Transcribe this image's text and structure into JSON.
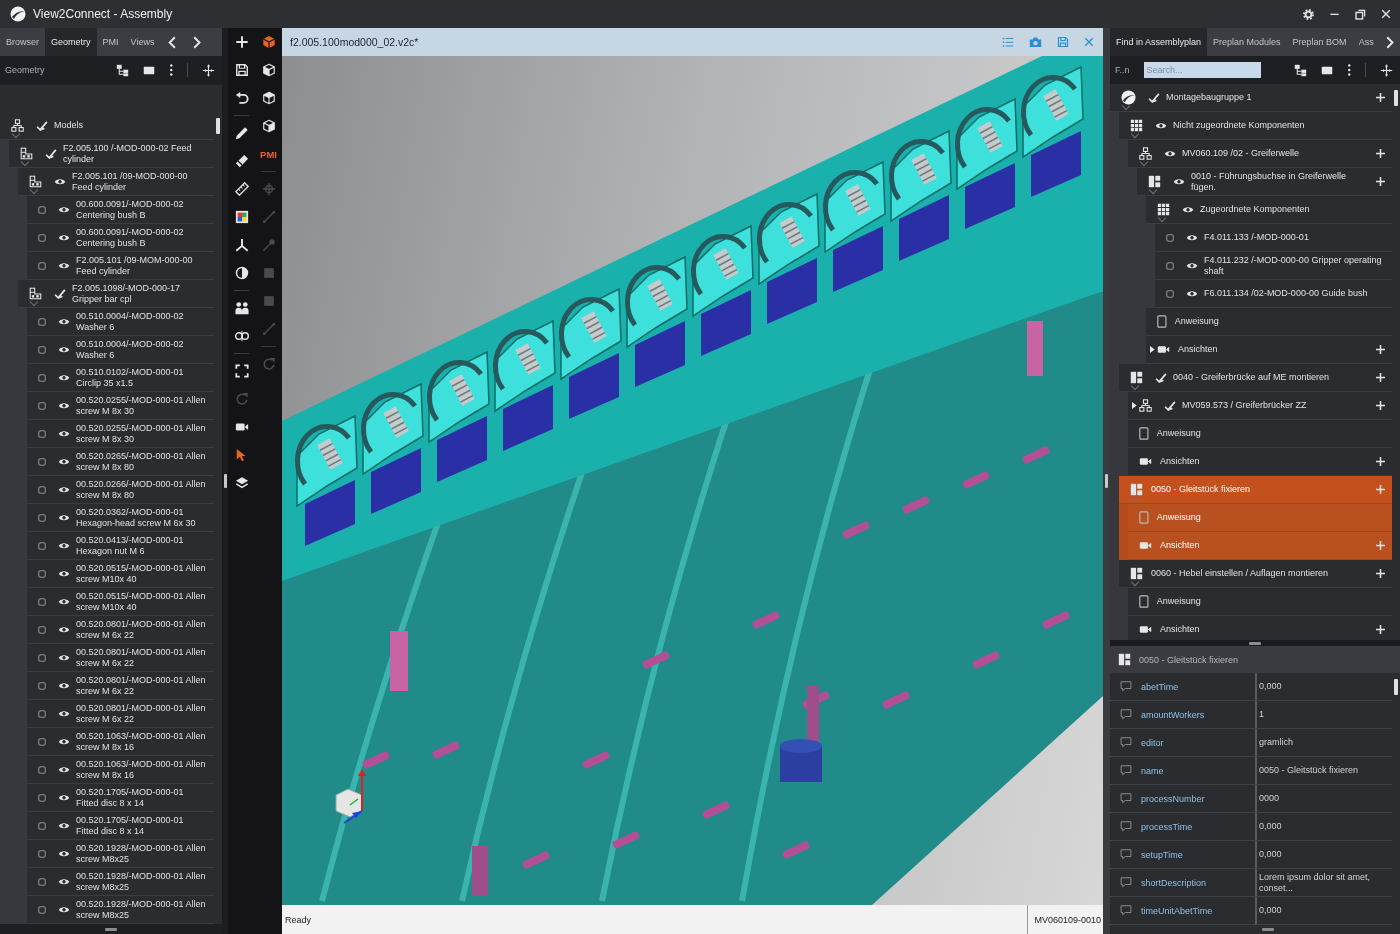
{
  "window": {
    "title": "View2Connect - Assembly"
  },
  "left_panel": {
    "tabs": [
      {
        "label": "Browser",
        "selected": false
      },
      {
        "label": "Geometry",
        "selected": true
      },
      {
        "label": "PMI",
        "selected": false
      },
      {
        "label": "Views",
        "selected": false
      }
    ],
    "toolbar_label": "Geometry",
    "tree": [
      {
        "kind": "hierarchy",
        "label": "Models",
        "mixed_visibility": true,
        "expanded": true,
        "selected": false,
        "children": [
          {
            "kind": "assembly",
            "label": "F2.005.100 /-MOD-000-02 Feed cylinder",
            "mixed_visibility": true,
            "expanded": true,
            "selected": false,
            "children": [
              {
                "kind": "assembly",
                "label": "F2.005.101 /09-MOD-000-00 Feed cylinder",
                "mixed_visibility": false,
                "expanded": true,
                "selected": false,
                "children": [
                  {
                    "kind": "part",
                    "label": "00.600.0091/-MOD-000-02 Centering bush B",
                    "mixed_visibility": false,
                    "selected": false
                  },
                  {
                    "kind": "part",
                    "label": "00.600.0091/-MOD-000-02 Centering bush B",
                    "mixed_visibility": false,
                    "selected": false
                  },
                  {
                    "kind": "part",
                    "label": "F2.005.101 /09-MOM-000-00 Feed cylinder",
                    "mixed_visibility": false,
                    "selected": false
                  }
                ]
              },
              {
                "kind": "assembly",
                "label": "F2.005.1098/-MOD-000-17 Gripper bar cpl",
                "mixed_visibility": true,
                "expanded": true,
                "selected": false,
                "children": [
                  {
                    "kind": "part",
                    "label": "00.510.0004/-MOD-000-02 Washer 6",
                    "mixed_visibility": false,
                    "selected": false
                  },
                  {
                    "kind": "part",
                    "label": "00.510.0004/-MOD-000-02 Washer 6",
                    "mixed_visibility": false,
                    "selected": false
                  },
                  {
                    "kind": "part",
                    "label": "00.510.0102/-MOD-000-01 Circlip 35 x1.5",
                    "mixed_visibility": false,
                    "selected": false
                  },
                  {
                    "kind": "part",
                    "label": "00.520.0255/-MOD-000-01 Allen screw M 8x 30",
                    "mixed_visibility": false,
                    "selected": false
                  },
                  {
                    "kind": "part",
                    "label": "00.520.0255/-MOD-000-01 Allen screw M 8x 30",
                    "mixed_visibility": false,
                    "selected": false
                  },
                  {
                    "kind": "part",
                    "label": "00.520.0265/-MOD-000-01 Allen screw M 8x 80",
                    "mixed_visibility": false,
                    "selected": false
                  },
                  {
                    "kind": "part",
                    "label": "00.520.0266/-MOD-000-01 Allen screw M 8x 80",
                    "mixed_visibility": false,
                    "selected": false
                  },
                  {
                    "kind": "part",
                    "label": "00.520.0362/-MOD-000-01 Hexagon-head screw M 6x 30",
                    "mixed_visibility": false,
                    "selected": false
                  },
                  {
                    "kind": "part",
                    "label": "00.520.0413/-MOD-000-01 Hexagon nut M 6",
                    "mixed_visibility": false,
                    "selected": false
                  },
                  {
                    "kind": "part",
                    "label": "00.520.0515/-MOD-000-01 Allen screw M10x 40",
                    "mixed_visibility": false,
                    "selected": false
                  },
                  {
                    "kind": "part",
                    "label": "00.520.0515/-MOD-000-01 Allen screw M10x 40",
                    "mixed_visibility": false,
                    "selected": false
                  },
                  {
                    "kind": "part",
                    "label": "00.520.0801/-MOD-000-01 Allen screw M 6x 22",
                    "mixed_visibility": false,
                    "selected": false
                  },
                  {
                    "kind": "part",
                    "label": "00.520.0801/-MOD-000-01 Allen screw M 6x 22",
                    "mixed_visibility": false,
                    "selected": false
                  },
                  {
                    "kind": "part",
                    "label": "00.520.0801/-MOD-000-01 Allen screw M 6x 22",
                    "mixed_visibility": false,
                    "selected": false
                  },
                  {
                    "kind": "part",
                    "label": "00.520.0801/-MOD-000-01 Allen screw M 6x 22",
                    "mixed_visibility": false,
                    "selected": false
                  },
                  {
                    "kind": "part",
                    "label": "00.520.1063/-MOD-000-01 Allen screw M 8x 16",
                    "mixed_visibility": false,
                    "selected": false
                  },
                  {
                    "kind": "part",
                    "label": "00.520.1063/-MOD-000-01 Allen screw M 8x 16",
                    "mixed_visibility": false,
                    "selected": false
                  },
                  {
                    "kind": "part",
                    "label": "00.520.1705/-MOD-000-01 Fitted disc 8 x 14",
                    "mixed_visibility": false,
                    "selected": false
                  },
                  {
                    "kind": "part",
                    "label": "00.520.1705/-MOD-000-01 Fitted disc 8 x 14",
                    "mixed_visibility": false,
                    "selected": false
                  },
                  {
                    "kind": "part",
                    "label": "00.520.1928/-MOD-000-01 Allen screw M8x25",
                    "mixed_visibility": false,
                    "selected": false
                  },
                  {
                    "kind": "part",
                    "label": "00.520.1928/-MOD-000-01 Allen screw M8x25",
                    "mixed_visibility": false,
                    "selected": false
                  },
                  {
                    "kind": "part",
                    "label": "00.520.1928/-MOD-000-01 Allen screw M8x25",
                    "mixed_visibility": false,
                    "selected": false
                  }
                ]
              }
            ]
          }
        ]
      }
    ]
  },
  "toolbar": {
    "left_tools": [
      {
        "disabled": false
      },
      {
        "disabled": false
      },
      {
        "disabled": false
      },
      {
        "disabled": false
      },
      {
        "disabled": false
      },
      {
        "disabled": false
      },
      {
        "disabled": false
      },
      {
        "disabled": false
      },
      {
        "disabled": false
      },
      {
        "disabled": false
      },
      {
        "disabled": false
      },
      {
        "disabled": false
      },
      {
        "disabled": true
      },
      {
        "disabled": false
      },
      {
        "disabled": false
      },
      {
        "disabled": false
      }
    ],
    "right_tools": [
      {
        "kind": "icon",
        "disabled": false
      },
      {
        "kind": "icon",
        "disabled": false
      },
      {
        "kind": "icon",
        "disabled": false
      },
      {
        "kind": "icon",
        "disabled": false
      },
      {
        "kind": "text",
        "label": "PMI",
        "disabled": false
      },
      {
        "kind": "icon",
        "disabled": true
      },
      {
        "kind": "icon",
        "disabled": true
      },
      {
        "kind": "icon",
        "disabled": true
      },
      {
        "kind": "icon",
        "disabled": true
      },
      {
        "kind": "icon",
        "disabled": true
      },
      {
        "kind": "icon",
        "disabled": true
      },
      {
        "kind": "icon",
        "disabled": true
      }
    ]
  },
  "viewport": {
    "document_title": "f2.005.100mod000_02.v2c*"
  },
  "status_bar": {
    "message": "Ready",
    "item_id": "MV060109-0010"
  },
  "right_panel": {
    "tabs": [
      {
        "label": "Find in Assemblyplan",
        "selected": true
      },
      {
        "label": "Preplan Modules",
        "selected": false
      },
      {
        "label": "Preplan BOM",
        "selected": false
      },
      {
        "label": "Ass",
        "selected": false
      }
    ],
    "toolbar_label": "F..n",
    "search": {
      "placeholder": "Search..."
    },
    "tree": [
      {
        "kind": "root",
        "label": "Montagebaugruppe 1",
        "mixed_visibility": true,
        "expanded": true,
        "selected": false,
        "add_button": true,
        "children": [
          {
            "kind": "components",
            "label": "Nicht zugeordnete Komponenten",
            "mixed_visibility": false,
            "expanded": true,
            "selected": false,
            "add_button": false,
            "children": [
              {
                "kind": "hierarchy",
                "label": "MV060.109 /02 - Greiferwelle",
                "mixed_visibility": false,
                "expanded": true,
                "selected": false,
                "add_button": true,
                "children": [
                  {
                    "kind": "process",
                    "label": "0010 - Führungsbuchse in Greiferwelle fügen.",
                    "mixed_visibility": false,
                    "expanded": true,
                    "selected": false,
                    "add_button": true,
                    "children": [
                      {
                        "kind": "components",
                        "label": "Zugeordnete Komponenten",
                        "mixed_visibility": false,
                        "expanded": true,
                        "selected": false,
                        "add_button": false,
                        "children": [
                          {
                            "kind": "part",
                            "label": "F4.011.133 /-MOD-000-01",
                            "mixed_visibility": false,
                            "selected": false,
                            "add_button": false
                          },
                          {
                            "kind": "part",
                            "label": "F4.011.232 /-MOD-000-00 Gripper operating shaft",
                            "mixed_visibility": false,
                            "selected": false,
                            "add_button": false
                          },
                          {
                            "kind": "part",
                            "label": "F6.011.134 /02-MOD-000-00 Guide bush",
                            "mixed_visibility": false,
                            "selected": false,
                            "add_button": false
                          }
                        ]
                      },
                      {
                        "kind": "instruction",
                        "label": "Anweisung",
                        "selected": false,
                        "add_button": false
                      },
                      {
                        "kind": "views",
                        "label": "Ansichten",
                        "expanded": false,
                        "selected": false,
                        "add_button": true
                      }
                    ]
                  }
                ]
              }
            ]
          },
          {
            "kind": "process",
            "label": "0040 - Greiferbrücke auf ME montieren",
            "mixed_visibility": true,
            "expanded": true,
            "selected": false,
            "add_button": true,
            "children": [
              {
                "kind": "hierarchy",
                "label": "MV059.573 / Greiferbrücker ZZ",
                "mixed_visibility": true,
                "expanded": false,
                "selected": false,
                "add_button": true
              },
              {
                "kind": "instruction",
                "label": "Anweisung",
                "selected": false,
                "add_button": false
              },
              {
                "kind": "views",
                "label": "Ansichten",
                "selected": false,
                "add_button": true
              }
            ]
          },
          {
            "kind": "process",
            "label": "0050 - Gleitstück fixieren",
            "expanded": true,
            "selected": true,
            "add_button": true,
            "children": [
              {
                "kind": "instruction",
                "label": "Anweisung",
                "selected": true,
                "add_button": false
              },
              {
                "kind": "views",
                "label": "Ansichten",
                "selected": true,
                "add_button": true
              }
            ]
          },
          {
            "kind": "process",
            "label": "0060 - Hebel einstellen / Auflagen montieren",
            "expanded": true,
            "selected": false,
            "add_button": true,
            "children": [
              {
                "kind": "instruction",
                "label": "Anweisung",
                "selected": false,
                "add_button": false
              },
              {
                "kind": "views",
                "label": "Ansichten",
                "selected": false,
                "add_button": true
              }
            ]
          }
        ]
      }
    ],
    "properties": {
      "title": "0050 - Gleitstück fixieren",
      "rows": [
        {
          "name": "abetTime",
          "value": "0,000"
        },
        {
          "name": "amountWorkers",
          "value": "1"
        },
        {
          "name": "editor",
          "value": "gramlich"
        },
        {
          "name": "name",
          "value": "0050 - Gleitstück fixieren"
        },
        {
          "name": "processNumber",
          "value": "0000"
        },
        {
          "name": "processTime",
          "value": "0,000"
        },
        {
          "name": "setupTime",
          "value": "0,000"
        },
        {
          "name": "shortDescription",
          "value": "Lorem ipsum dolor sit amet, conset..."
        },
        {
          "name": "timeUnitAbetTime",
          "value": "0,000"
        }
      ]
    }
  }
}
